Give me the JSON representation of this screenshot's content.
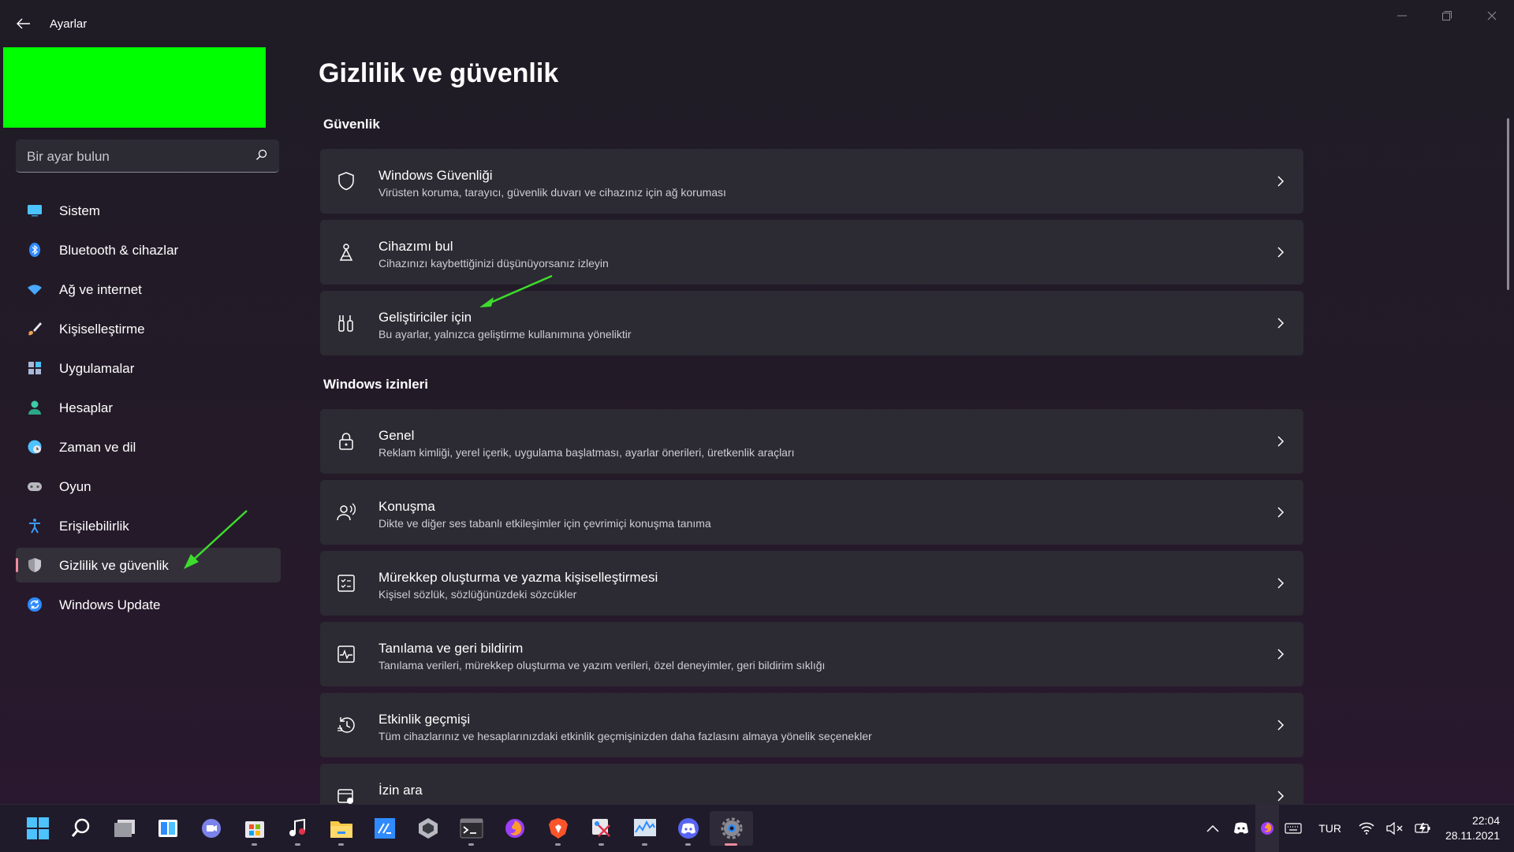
{
  "window": {
    "title": "Ayarlar"
  },
  "sidebar": {
    "search_placeholder": "Bir ayar bulun",
    "items": [
      {
        "label": "Sistem",
        "icon": "monitor-icon",
        "color": "#4cc2ff"
      },
      {
        "label": "Bluetooth & cihazlar",
        "icon": "bluetooth-icon",
        "color": "#2f8bff"
      },
      {
        "label": "Ağ ve internet",
        "icon": "wifi-icon",
        "color": "#4aa8ff"
      },
      {
        "label": "Kişiselleştirme",
        "icon": "brush-icon",
        "color": "#f0a050"
      },
      {
        "label": "Uygulamalar",
        "icon": "apps-icon",
        "color": "#a8b8d8"
      },
      {
        "label": "Hesaplar",
        "icon": "person-icon",
        "color": "#3ec9a7"
      },
      {
        "label": "Zaman ve dil",
        "icon": "globe-clock-icon",
        "color": "#4cc2ff"
      },
      {
        "label": "Oyun",
        "icon": "gamepad-icon",
        "color": "#b8b8c0"
      },
      {
        "label": "Erişilebilirlik",
        "icon": "accessibility-icon",
        "color": "#3a9bff"
      },
      {
        "label": "Gizlilik ve güvenlik",
        "icon": "shield-icon",
        "color": "#9a9aa2",
        "active": true
      },
      {
        "label": "Windows Update",
        "icon": "update-icon",
        "color": "#2f8bff"
      }
    ]
  },
  "main": {
    "page_title": "Gizlilik ve güvenlik",
    "sections": [
      {
        "title": "Güvenlik",
        "items": [
          {
            "title": "Windows Güvenliği",
            "desc": "Virüsten koruma, tarayıcı, güvenlik duvarı ve cihazınız için ağ koruması",
            "icon": "shield-icon"
          },
          {
            "title": "Cihazımı bul",
            "desc": "Cihazınızı kaybettiğinizi düşünüyorsanız izleyin",
            "icon": "find-device-icon"
          },
          {
            "title": "Geliştiriciler için",
            "desc": "Bu ayarlar, yalnızca geliştirme kullanımına yöneliktir",
            "icon": "developer-tools-icon"
          }
        ]
      },
      {
        "title": "Windows izinleri",
        "items": [
          {
            "title": "Genel",
            "desc": "Reklam kimliği, yerel içerik, uygulama başlatması, ayarlar önerileri, üretkenlik araçları",
            "icon": "lock-icon"
          },
          {
            "title": "Konuşma",
            "desc": "Dikte ve diğer ses tabanlı etkileşimler için çevrimiçi konuşma tanıma",
            "icon": "speech-icon"
          },
          {
            "title": "Mürekkep oluşturma ve yazma kişiselleştirmesi",
            "desc": "Kişisel sözlük, sözlüğünüzdeki sözcükler",
            "icon": "ink-dictionary-icon"
          },
          {
            "title": "Tanılama ve geri bildirim",
            "desc": "Tanılama verileri, mürekkep oluşturma ve yazım verileri, özel deneyimler, geri bildirim sıklığı",
            "icon": "diagnostics-icon"
          },
          {
            "title": "Etkinlik geçmişi",
            "desc": "Tüm cihazlarınız ve hesaplarınızdaki etkinlik geçmişinizden daha fazlasını almaya yönelik seçenekler",
            "icon": "history-icon"
          },
          {
            "title": "İzin ara",
            "desc": "",
            "icon": "search-permission-icon"
          }
        ]
      }
    ]
  },
  "taskbar": {
    "apps": [
      "windows-start-icon",
      "search-icon",
      "task-view-icon",
      "widgets-icon",
      "chat-icon",
      "store-icon",
      "music-icon",
      "file-explorer-icon",
      "vscode-icon",
      "unity-icon",
      "terminal-icon",
      "firefox-icon",
      "brave-icon",
      "snipping-icon",
      "resource-monitor-icon",
      "discord-icon",
      "settings-icon"
    ],
    "language": "TUR",
    "time": "22:04",
    "date": "28.11.2021"
  },
  "colors": {
    "accent_pill": "#f08ba0",
    "annotation_arrow": "#3ddc2c",
    "highlight_block": "#00ff00"
  }
}
